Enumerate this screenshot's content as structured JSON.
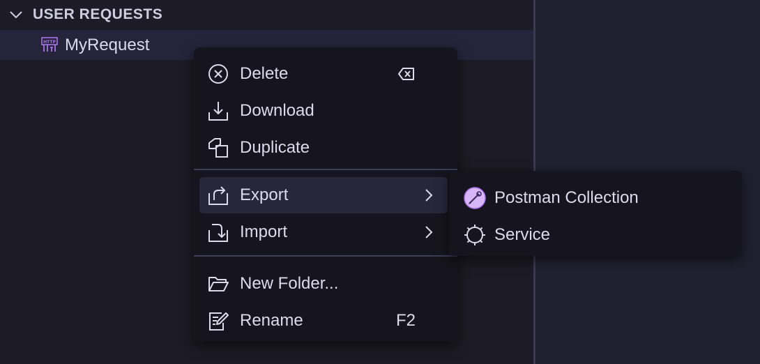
{
  "explorer": {
    "section_title": "USER REQUESTS",
    "tree_item_label": "MyRequest"
  },
  "context_menu": {
    "items": [
      {
        "label": "Delete",
        "icon": "circle-x-icon",
        "shortcut_icon": "backspace-icon"
      },
      {
        "label": "Download",
        "icon": "download-icon"
      },
      {
        "label": "Duplicate",
        "icon": "duplicate-icon"
      },
      {
        "label": "Export",
        "icon": "export-icon",
        "submenu": true
      },
      {
        "label": "Import",
        "icon": "import-icon",
        "submenu": true
      },
      {
        "label": "New Folder...",
        "icon": "folder-open-icon"
      },
      {
        "label": "Rename",
        "icon": "rename-icon",
        "shortcut": "F2"
      }
    ]
  },
  "export_submenu": {
    "items": [
      {
        "label": "Postman Collection",
        "icon": "postman-icon"
      },
      {
        "label": "Service",
        "icon": "service-gear-icon"
      }
    ]
  },
  "colors": {
    "accent": "#a874e8",
    "menu_bg": "#16151f",
    "active_bg": "#28273a",
    "text": "#dcdaeb"
  }
}
